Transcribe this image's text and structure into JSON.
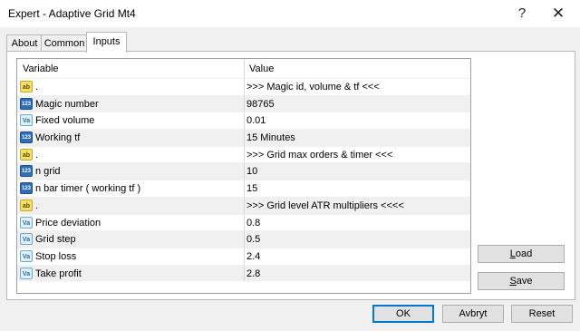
{
  "window": {
    "title": "Expert - Adaptive Grid Mt4",
    "help_glyph": "?",
    "close_glyph": "✕"
  },
  "tabs": [
    {
      "label": "About",
      "active": false
    },
    {
      "label": "Common",
      "active": false
    },
    {
      "label": "Inputs",
      "active": true
    }
  ],
  "grid": {
    "headers": {
      "variable": "Variable",
      "value": "Value"
    },
    "rows": [
      {
        "icon": "ab",
        "name": ".",
        "value": ">>> Magic id, volume & tf <<<"
      },
      {
        "icon": "123",
        "name": "Magic number",
        "value": "98765"
      },
      {
        "icon": "Va",
        "name": "Fixed volume",
        "value": "0.01"
      },
      {
        "icon": "123",
        "name": "Working tf",
        "value": "15 Minutes"
      },
      {
        "icon": "ab",
        "name": ".",
        "value": ">>> Grid max orders & timer <<<"
      },
      {
        "icon": "123",
        "name": "n grid",
        "value": "10"
      },
      {
        "icon": "123",
        "name": "n bar timer ( working tf )",
        "value": "15"
      },
      {
        "icon": "ab",
        "name": ".",
        "value": ">>> Grid level ATR multipliers <<<<"
      },
      {
        "icon": "Va",
        "name": "Price deviation",
        "value": "0.8"
      },
      {
        "icon": "Va",
        "name": "Grid step",
        "value": "0.5"
      },
      {
        "icon": "Va",
        "name": "Stop loss",
        "value": "2.4"
      },
      {
        "icon": "Va",
        "name": "Take profit",
        "value": "2.8"
      }
    ]
  },
  "side_buttons": {
    "load": {
      "u": "L",
      "rest": "oad"
    },
    "save": {
      "u": "S",
      "rest": "ave"
    }
  },
  "footer_buttons": {
    "ok": "OK",
    "cancel": "Avbryt",
    "reset": "Reset"
  },
  "colors": {
    "accent": "#0078d7",
    "alt_row": "#f0f0f0"
  }
}
